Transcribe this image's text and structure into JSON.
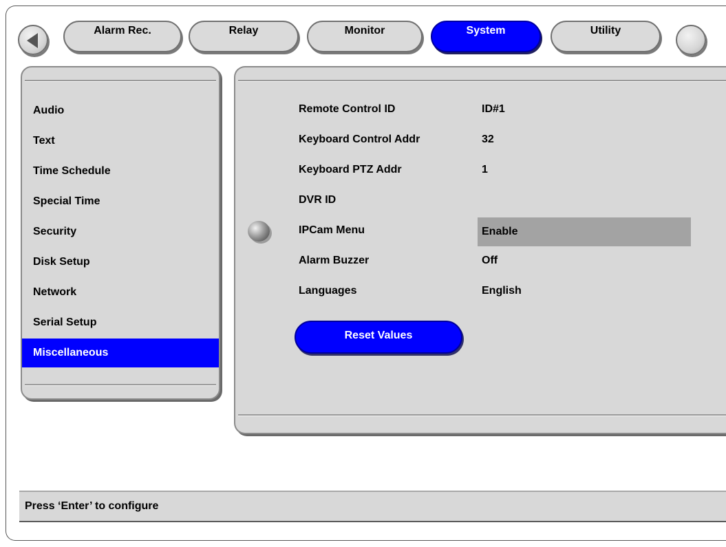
{
  "tabs": [
    {
      "label": "Alarm Rec."
    },
    {
      "label": "Relay"
    },
    {
      "label": "Monitor"
    },
    {
      "label": "System",
      "active": true
    },
    {
      "label": "Utility"
    }
  ],
  "sidebar": {
    "items": [
      {
        "label": "Audio"
      },
      {
        "label": "Text"
      },
      {
        "label": "Time Schedule"
      },
      {
        "label": "Special Time"
      },
      {
        "label": "Security"
      },
      {
        "label": "Disk Setup"
      },
      {
        "label": "Network"
      },
      {
        "label": "Serial Setup"
      },
      {
        "label": "Miscellaneous",
        "selected": true
      }
    ]
  },
  "settings": [
    {
      "label": "Remote Control ID",
      "value": "ID#1"
    },
    {
      "label": "Keyboard Control Addr",
      "value": "32"
    },
    {
      "label": "Keyboard PTZ Addr",
      "value": "1"
    },
    {
      "label": "DVR ID",
      "value": ""
    },
    {
      "label": "IPCam Menu",
      "value": "Enable",
      "focused": true
    },
    {
      "label": "Alarm Buzzer",
      "value": "Off"
    },
    {
      "label": "Languages",
      "value": "English"
    }
  ],
  "reset_button": {
    "label": "Reset Values"
  },
  "status_bar": {
    "text": "Press ‘Enter’ to configure"
  },
  "colors": {
    "accent": "#0000ff",
    "panel": "#d8d8d8",
    "highlight": "#a3a3a3"
  },
  "icons": {
    "nav_left": "arrow-left-icon",
    "cursor": "selection-ball-icon"
  }
}
